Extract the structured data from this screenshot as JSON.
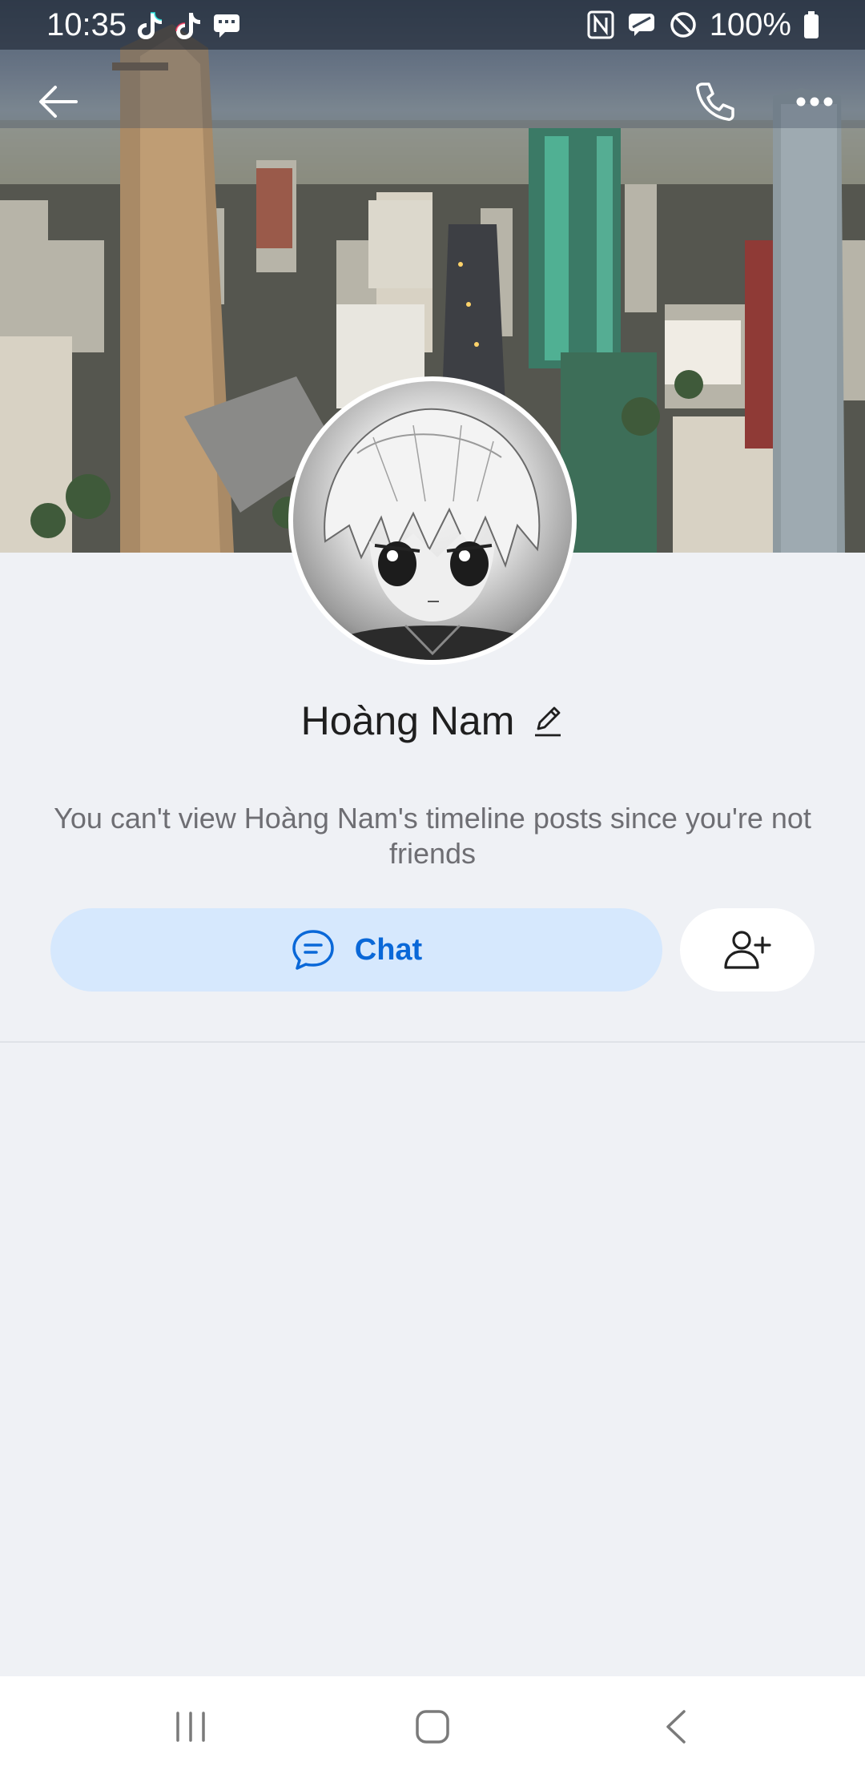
{
  "status_bar": {
    "time": "10:35",
    "battery_text": "100%",
    "left_icons": [
      "tiktok-icon",
      "tiktok-icon",
      "message-notification-icon"
    ],
    "right_icons": [
      "nfc-icon",
      "mic-off-icon",
      "do-not-disturb-icon",
      "battery-icon"
    ]
  },
  "header": {
    "back_icon": "arrow-left-icon",
    "call_icon": "phone-icon",
    "more_icon": "more-horizontal-icon"
  },
  "profile": {
    "name": "Hoàng Nam",
    "edit_icon": "pencil-icon",
    "notice": "You can't view Hoàng Nam's timeline posts since you're not friends"
  },
  "actions": {
    "chat_label": "Chat",
    "chat_icon": "chat-bubble-icon",
    "add_friend_icon": "add-friend-icon"
  },
  "nav_bar": {
    "recents_icon": "recent-apps-icon",
    "home_icon": "home-icon",
    "back_icon": "back-icon"
  },
  "colors": {
    "accent": "#0a68d8",
    "chat_button_bg": "#d6e8fd",
    "page_bg": "#eff1f5"
  }
}
